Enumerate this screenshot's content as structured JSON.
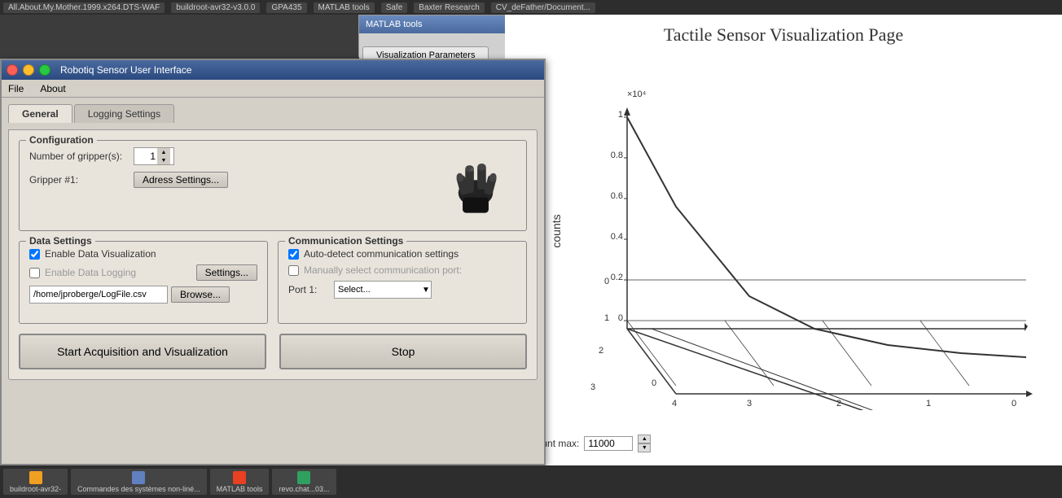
{
  "taskbar_top": {
    "items": [
      {
        "label": "All.About.My.Mother.1999.x264.DTS-WAF"
      },
      {
        "label": "buildroot-avr32-v3.0.0"
      },
      {
        "label": "GPA435"
      },
      {
        "label": "MATLAB tools"
      },
      {
        "label": "Safe"
      },
      {
        "label": "Baxter Research"
      },
      {
        "label": "CV_deFather/Document..."
      }
    ]
  },
  "taskbar_bottom": {
    "items": [
      {
        "label": "buildroot-avr32-",
        "sublabel": "..."
      },
      {
        "label": "Commandes des systèmes non-liné..."
      },
      {
        "label": "MATLAB tools"
      },
      {
        "label": "revo.chat...03..."
      }
    ]
  },
  "matlab_window": {
    "title": "MATLAB tools",
    "tabs": [
      {
        "label": "Visualization Parameters",
        "active": true
      }
    ]
  },
  "tactile_window": {
    "title": "Tactile Sensor Visualization Page",
    "chart": {
      "y_label": "counts",
      "x_scale_label": "×10⁴",
      "y_axis_values": [
        "1",
        "0.8",
        "0.6",
        "0.4",
        "0.2",
        "0"
      ],
      "x_axis_values": [
        "3",
        "2",
        "1",
        "0"
      ],
      "diagonal_x_labels": [
        "4",
        "3",
        "2",
        "1",
        "0"
      ],
      "diagonal_y_labels": [
        "0",
        "1",
        "2",
        "3"
      ]
    },
    "count_max_label": "Count max:",
    "count_max_value": "11000"
  },
  "robotiq_window": {
    "title": "Robotiq Sensor User Interface",
    "menu": {
      "items": [
        "File",
        "About"
      ]
    },
    "tabs": [
      {
        "label": "General",
        "active": true
      },
      {
        "label": "Logging Settings",
        "active": false
      }
    ],
    "configuration": {
      "section_title": "Configuration",
      "num_grippers_label": "Number of gripper(s):",
      "num_grippers_value": "1",
      "gripper1_label": "Gripper #1:",
      "address_btn": "Adress Settings..."
    },
    "data_settings": {
      "section_title": "Data Settings",
      "enable_viz_label": "Enable Data Visualization",
      "enable_viz_checked": true,
      "enable_log_label": "Enable Data Logging",
      "enable_log_checked": false,
      "settings_btn": "Settings...",
      "file_path": "/home/jproberge/LogFile.csv",
      "browse_btn": "Browse..."
    },
    "comm_settings": {
      "section_title": "Communication Settings",
      "auto_detect_label": "Auto-detect communication settings",
      "auto_detect_checked": true,
      "manual_select_label": "Manually select communication port:",
      "manual_select_checked": false,
      "port_label": "Port 1:",
      "port_placeholder": "Select..."
    },
    "actions": {
      "start_btn": "Start Acquisition and Visualization",
      "stop_btn": "Stop"
    }
  }
}
